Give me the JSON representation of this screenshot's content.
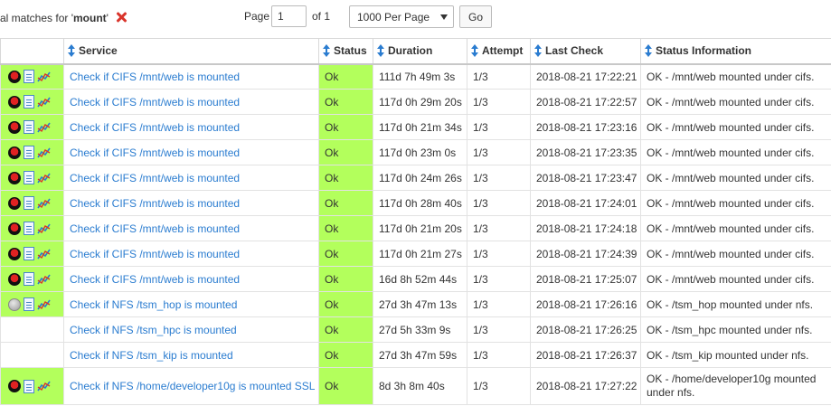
{
  "search": {
    "prefix": "al matches for '",
    "term": "mount",
    "suffix": "'"
  },
  "pager": {
    "page_label": "Page",
    "page_value": "1",
    "of_label": "of 1",
    "per_page": "1000 Per Page",
    "go_label": "Go"
  },
  "columns": {
    "service": "Service",
    "status": "Status",
    "duration": "Duration",
    "attempt": "Attempt",
    "last_check": "Last Check",
    "info": "Status Information"
  },
  "colors": {
    "ok_green": "#b3ff5c",
    "link_blue": "#2a7cd0",
    "clear_red": "#d9342b"
  },
  "rows": [
    {
      "icon": "redhat-icon",
      "service": "Check if CIFS /mnt/web is mounted",
      "status": "Ok",
      "duration": "111d 7h 49m 3s",
      "attempt": "1/3",
      "last_check": "2018-08-21 17:22:21",
      "info": "OK - /mnt/web mounted under cifs."
    },
    {
      "icon": "redhat-icon",
      "service": "Check if CIFS /mnt/web is mounted",
      "status": "Ok",
      "duration": "117d 0h 29m 20s",
      "attempt": "1/3",
      "last_check": "2018-08-21 17:22:57",
      "info": "OK - /mnt/web mounted under cifs."
    },
    {
      "icon": "redhat-icon",
      "service": "Check if CIFS /mnt/web is mounted",
      "status": "Ok",
      "duration": "117d 0h 21m 34s",
      "attempt": "1/3",
      "last_check": "2018-08-21 17:23:16",
      "info": "OK - /mnt/web mounted under cifs."
    },
    {
      "icon": "redhat-icon",
      "service": "Check if CIFS /mnt/web is mounted",
      "status": "Ok",
      "duration": "117d 0h 23m 0s",
      "attempt": "1/3",
      "last_check": "2018-08-21 17:23:35",
      "info": "OK - /mnt/web mounted under cifs."
    },
    {
      "icon": "redhat-icon",
      "service": "Check if CIFS /mnt/web is mounted",
      "status": "Ok",
      "duration": "117d 0h 24m 26s",
      "attempt": "1/3",
      "last_check": "2018-08-21 17:23:47",
      "info": "OK - /mnt/web mounted under cifs."
    },
    {
      "icon": "redhat-icon",
      "service": "Check if CIFS /mnt/web is mounted",
      "status": "Ok",
      "duration": "117d 0h 28m 40s",
      "attempt": "1/3",
      "last_check": "2018-08-21 17:24:01",
      "info": "OK - /mnt/web mounted under cifs."
    },
    {
      "icon": "redhat-icon",
      "service": "Check if CIFS /mnt/web is mounted",
      "status": "Ok",
      "duration": "117d 0h 21m 20s",
      "attempt": "1/3",
      "last_check": "2018-08-21 17:24:18",
      "info": "OK - /mnt/web mounted under cifs."
    },
    {
      "icon": "redhat-icon",
      "service": "Check if CIFS /mnt/web is mounted",
      "status": "Ok",
      "duration": "117d 0h 21m 27s",
      "attempt": "1/3",
      "last_check": "2018-08-21 17:24:39",
      "info": "OK - /mnt/web mounted under cifs."
    },
    {
      "icon": "redhat-icon",
      "service": "Check if CIFS /mnt/web is mounted",
      "status": "Ok",
      "duration": "16d 8h 52m 44s",
      "attempt": "1/3",
      "last_check": "2018-08-21 17:25:07",
      "info": "OK - /mnt/web mounted under cifs."
    },
    {
      "icon": "host-ok-icon",
      "service": "Check if NFS /tsm_hop is mounted",
      "status": "Ok",
      "duration": "27d 3h 47m 13s",
      "attempt": "1/3",
      "last_check": "2018-08-21 17:26:16",
      "info": "OK - /tsm_hop mounted under nfs."
    },
    {
      "icon": "",
      "service": "Check if NFS /tsm_hpc is mounted",
      "status": "Ok",
      "duration": "27d 5h 33m 9s",
      "attempt": "1/3",
      "last_check": "2018-08-21 17:26:25",
      "info": "OK - /tsm_hpc mounted under nfs."
    },
    {
      "icon": "",
      "service": "Check if NFS /tsm_kip is mounted",
      "status": "Ok",
      "duration": "27d 3h 47m 59s",
      "attempt": "1/3",
      "last_check": "2018-08-21 17:26:37",
      "info": "OK - /tsm_kip mounted under nfs."
    },
    {
      "icon": "redhat-icon",
      "service": "Check if NFS /home/developer10g is mounted SSL",
      "status": "Ok",
      "duration": "8d 3h 8m 40s",
      "attempt": "1/3",
      "last_check": "2018-08-21 17:27:22",
      "info": "OK - /home/developer10g mounted under nfs."
    }
  ]
}
